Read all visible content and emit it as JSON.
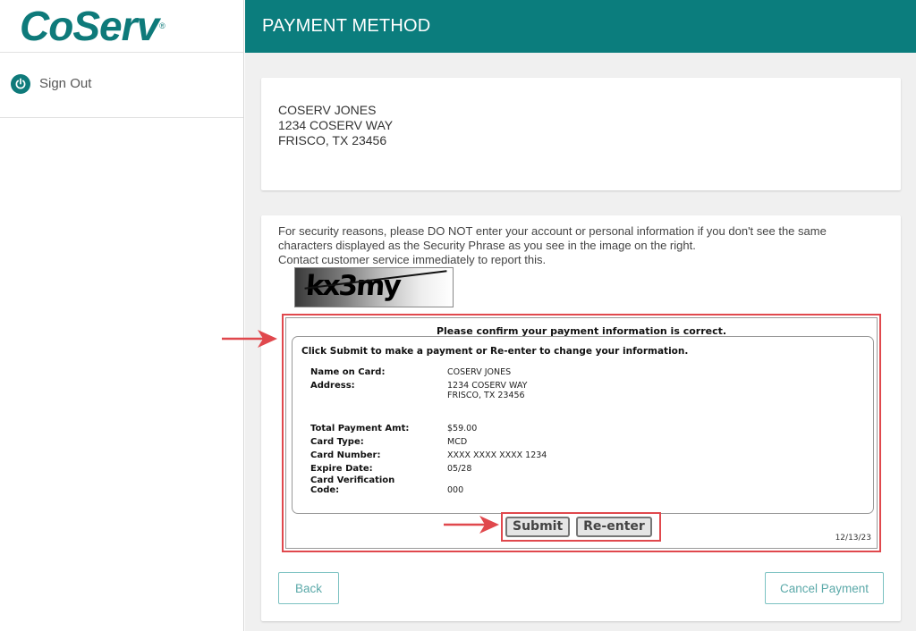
{
  "brand": {
    "name": "CoServ",
    "registered": "®",
    "color": "#0e7a7a"
  },
  "sidebar": {
    "signout_label": "Sign Out",
    "signout_icon": "power-icon"
  },
  "header": {
    "title": "PAYMENT METHOD",
    "color": "#0b7d7d"
  },
  "address": {
    "lines": [
      "COSERV JONES",
      "1234 COSERV WAY",
      "FRISCO, TX 23456"
    ]
  },
  "security": {
    "message": "For security reasons, please DO NOT enter your account or personal information if you don't see the same characters displayed as the Security Phrase as you see in the image on the right.",
    "contact": "Contact customer service immediately to report this.",
    "phrase": "kx3my"
  },
  "confirm": {
    "title": "Please confirm your payment information is correct.",
    "hint": "Click Submit to make a payment or Re-enter to change your information.",
    "name_label": "Name on Card:",
    "name_value": "COSERV JONES",
    "address_label": "Address:",
    "address_line1": "1234 COSERV WAY",
    "address_line2": "FRISCO, TX 23456",
    "amount_label": "Total Payment Amt:",
    "amount_value": "$59.00",
    "card_type_label": "Card Type:",
    "card_type_value": "MCD",
    "card_number_label": "Card Number:",
    "card_number_value": "XXXX XXXX XXXX 1234",
    "expire_label": "Expire Date:",
    "expire_value": "05/28",
    "cvc_label_line1": "Card Verification",
    "cvc_label_line2": "Code:",
    "cvc_value": "000",
    "submit_label": "Submit",
    "reenter_label": "Re-enter",
    "date": "12/13/23"
  },
  "actions": {
    "back_label": "Back",
    "cancel_label": "Cancel Payment"
  },
  "annotation_color": "#e0484d"
}
